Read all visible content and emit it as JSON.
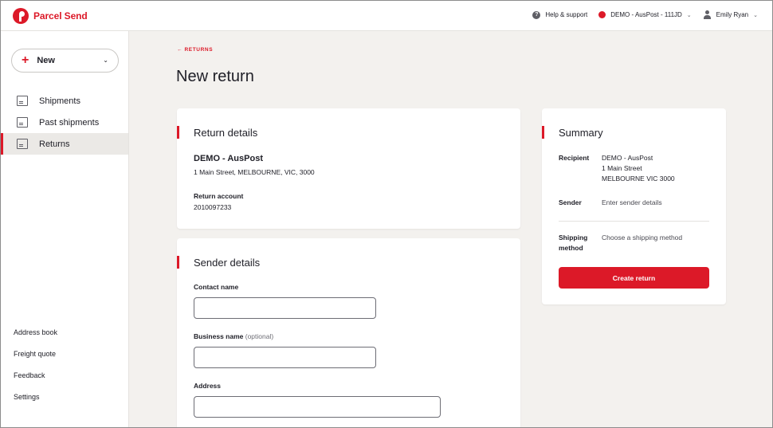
{
  "app": {
    "brand": "Parcel Send",
    "brand_color": "#dc1928"
  },
  "topbar": {
    "help_label": "Help & support",
    "account_label": "DEMO - AusPost - 111JD",
    "user_name": "Emily Ryan"
  },
  "sidebar": {
    "new_label": "New",
    "items": [
      {
        "label": "Shipments",
        "icon": "box-icon",
        "active": false
      },
      {
        "label": "Past shipments",
        "icon": "box-clock-icon",
        "active": false
      },
      {
        "label": "Returns",
        "icon": "box-return-icon",
        "active": true
      }
    ],
    "footer_links": [
      "Address book",
      "Freight quote",
      "Feedback",
      "Settings"
    ]
  },
  "main": {
    "back_link": "← RETURNS",
    "title": "New return"
  },
  "return_details": {
    "title": "Return details",
    "name": "DEMO - AusPost",
    "address": "1 Main Street, MELBOURNE, VIC, 3000",
    "account_label": "Return account",
    "account_number": "2010097233"
  },
  "sender_details": {
    "title": "Sender details",
    "contact_label": "Contact name",
    "contact_value": "",
    "business_label": "Business name",
    "business_optional": "(optional)",
    "business_value": "",
    "address_label": "Address",
    "address_value": ""
  },
  "summary": {
    "title": "Summary",
    "recipient_label": "Recipient",
    "recipient_line1": "DEMO - AusPost",
    "recipient_line2": "1 Main Street",
    "recipient_line3": "MELBOURNE VIC 3000",
    "sender_label": "Sender",
    "sender_value": "Enter sender details",
    "shipping_label_1": "Shipping",
    "shipping_label_2": "method",
    "shipping_value": "Choose a shipping method",
    "create_label": "Create return"
  }
}
